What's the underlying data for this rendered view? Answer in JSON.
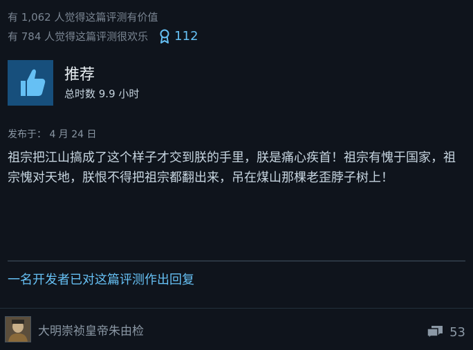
{
  "votes": {
    "helpful": "有 1,062 人觉得这篇评测有价值",
    "funny": "有 784 人觉得这篇评测很欢乐",
    "award_count": "112"
  },
  "review": {
    "recommendation": "推荐",
    "hours": "总时数 9.9 小时",
    "posted": "发布于： 4 月 24 日",
    "text": "祖宗把江山搞成了这个样子才交到朕的手里，朕是痛心疾首！祖宗有愧于国家，祖宗愧对天地，朕恨不得把祖宗都翻出来，吊在煤山那棵老歪脖子树上！",
    "developer_reply": "一名开发者已对这篇评测作出回复"
  },
  "author": {
    "name": "大明崇祯皇帝朱由检",
    "comment_count": "53"
  },
  "colors": {
    "background": "#0f141c",
    "accent": "#66c0f4",
    "thumb_bg": "#174f7c"
  }
}
